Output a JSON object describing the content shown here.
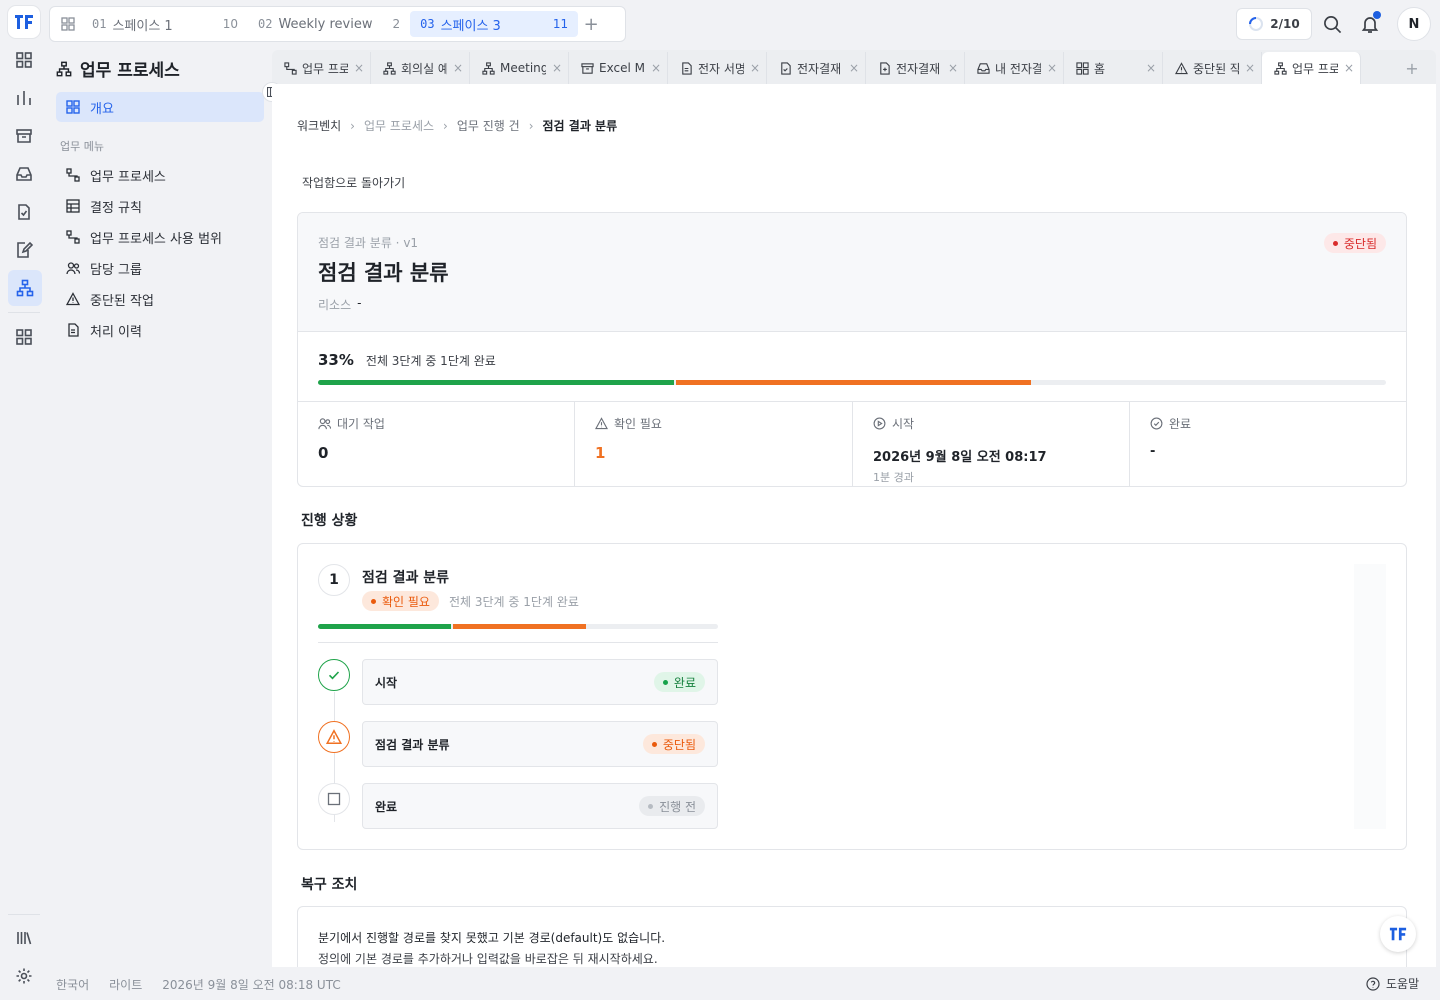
{
  "spaces": {
    "tabs": [
      {
        "num": "01",
        "label": "스페이스 1",
        "count": "10"
      },
      {
        "num": "02",
        "label": "Weekly review",
        "count": "2"
      },
      {
        "num": "03",
        "label": "스페이스 3",
        "count": "11"
      }
    ],
    "add_label": "+"
  },
  "topbar": {
    "task_count": "2/10",
    "avatar_initial": "N"
  },
  "sidebar": {
    "title": "업무 프로세스",
    "overview": "개요",
    "section_label": "업무 메뉴",
    "items": [
      {
        "label": "업무 프로세스",
        "icon": "flow-icon"
      },
      {
        "label": "결정 규칙",
        "icon": "table-icon"
      },
      {
        "label": "업무 프로세스 사용 범위",
        "icon": "flow-icon"
      },
      {
        "label": "담당 그룹",
        "icon": "users-icon"
      },
      {
        "label": "중단된 작업",
        "icon": "warning-icon"
      },
      {
        "label": "처리 이력",
        "icon": "document-icon"
      }
    ]
  },
  "tabs": [
    {
      "label": "업무 프로세스",
      "icon": "flow-icon"
    },
    {
      "label": "회의실 예약",
      "icon": "hierarchy-icon"
    },
    {
      "label": "Meeting",
      "icon": "hierarchy-icon"
    },
    {
      "label": "Excel M",
      "icon": "archive-icon"
    },
    {
      "label": "전자 서명",
      "icon": "document-icon"
    },
    {
      "label": "전자결재",
      "icon": "document-check-icon"
    },
    {
      "label": "전자결재",
      "icon": "document-plus-icon"
    },
    {
      "label": "내 전자결재",
      "icon": "inbox-icon"
    },
    {
      "label": "홈",
      "icon": "grid-icon"
    },
    {
      "label": "중단된 작업",
      "icon": "warning-icon"
    },
    {
      "label": "업무 프로세스",
      "icon": "hierarchy-icon"
    }
  ],
  "breadcrumb": [
    "워크벤치",
    "업무 프로세스",
    "업무 진행 건",
    "점검 결과 분류"
  ],
  "back_link": "작업함으로 돌아가기",
  "summary": {
    "meta": "점검 결과 분류 · v1",
    "title": "점검 결과 분류",
    "status": "중단됨",
    "resource_label": "리소스",
    "resource_value": "-",
    "percent": "33%",
    "progress_text": "전체 3단계 중 1단계 완료",
    "progress_done_pct": 33.3,
    "progress_active_pct": 33.3,
    "stats": [
      {
        "label": "대기 작업",
        "value": "0",
        "sub": "",
        "icon": "users-icon"
      },
      {
        "label": "확인 필요",
        "value": "1",
        "sub": "",
        "icon": "warning-icon"
      },
      {
        "label": "시작",
        "value": "2026년 9월 8일 오전 08:17",
        "sub": "1분 경과",
        "icon": "play-circle-icon"
      },
      {
        "label": "완료",
        "value": "-",
        "sub": "",
        "icon": "check-circle-icon"
      }
    ]
  },
  "progress_section": {
    "title": "진행 상황",
    "index": "1",
    "name": "점검 결과 분류",
    "badge": "확인 필요",
    "sub": "전체 3단계 중 1단계 완료",
    "steps": [
      {
        "label": "시작",
        "status": "완료",
        "icon": "check-icon"
      },
      {
        "label": "점검 결과 분류",
        "status": "중단됨",
        "icon": "warning-icon"
      },
      {
        "label": "완료",
        "status": "진행 전",
        "icon": "square-icon"
      }
    ]
  },
  "recovery": {
    "title": "복구 조치",
    "line1": "분기에서 진행할 경로를 찾지 못했고 기본 경로(default)도 없습니다.",
    "line2": "정의에 기본 경로를 추가하거나 입력값을 바로잡은 뒤 재시작하세요."
  },
  "footer": {
    "language": "한국어",
    "theme": "라이트",
    "time": "2026년 9월 8일 오전 08:18 UTC",
    "help": "도움말"
  },
  "colors": {
    "accent": "#2563eb",
    "success": "#1fa34a",
    "warning": "#f07122",
    "danger": "#d92b2b"
  }
}
